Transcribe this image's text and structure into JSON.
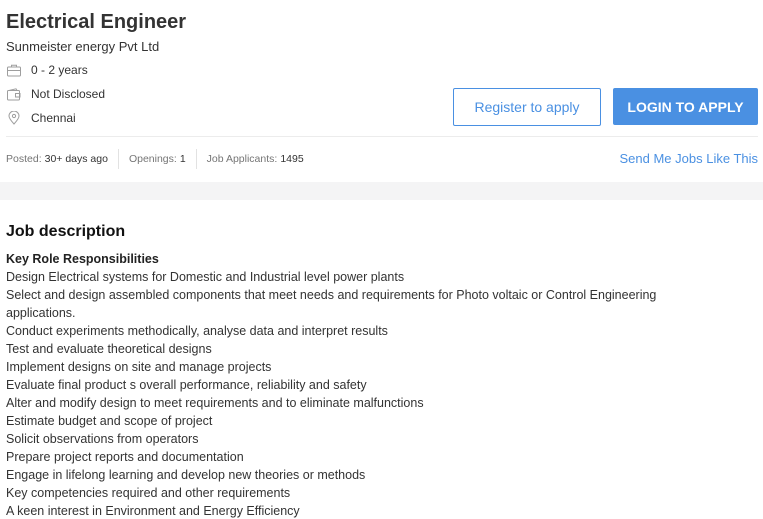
{
  "job": {
    "title": "Electrical Engineer",
    "company": "Sunmeister energy Pvt Ltd",
    "experience": "0 - 2 years",
    "salary": "Not Disclosed",
    "location": "Chennai"
  },
  "actions": {
    "register_label": "Register to apply",
    "login_label": "LOGIN TO APPLY",
    "send_jobs_label": "Send Me Jobs Like This"
  },
  "stats": {
    "posted_label": "Posted:",
    "posted_value": "30+ days ago",
    "openings_label": "Openings:",
    "openings_value": "1",
    "applicants_label": "Job Applicants:",
    "applicants_value": "1495"
  },
  "description": {
    "heading": "Job description",
    "subheading": "Key Role Responsibilities",
    "lines": [
      "Design Electrical systems for Domestic and Industrial level power plants",
      "Select and design assembled components that meet needs and requirements for Photo voltaic or Control Engineering applications.",
      "Conduct experiments methodically, analyse data and interpret results",
      "Test and evaluate theoretical designs",
      "Implement designs on site and manage projects",
      "Evaluate final product s overall performance, reliability and safety",
      "Alter and modify design to meet requirements and to eliminate malfunctions",
      "Estimate budget and scope of project",
      "Solicit observations from operators",
      "Prepare project reports and documentation",
      "Engage in lifelong learning and develop new theories or methods",
      "Key competencies required and other requirements",
      "A keen interest in Environment and Energy Efficiency"
    ]
  },
  "colors": {
    "accent": "#4a90e2",
    "text": "#333333",
    "muted": "#757575",
    "band": "#f4f4f5"
  },
  "icons": {
    "experience": "briefcase-icon",
    "salary": "wallet-icon",
    "location": "location-pin-icon"
  }
}
